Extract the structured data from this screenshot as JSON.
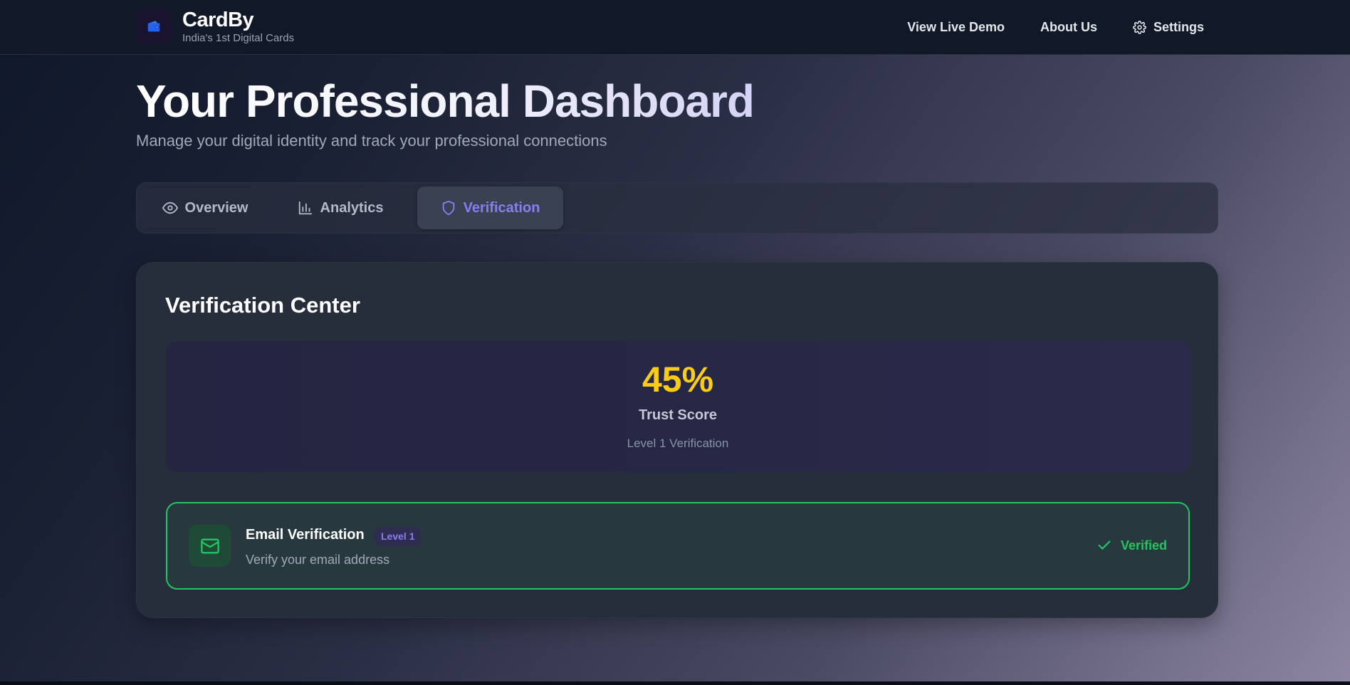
{
  "brand": {
    "name": "CardBy",
    "tagline": "India's 1st Digital Cards",
    "logo_icon": "wallet-icon"
  },
  "nav": {
    "items": [
      {
        "label": "View Live Demo"
      },
      {
        "label": "About Us"
      },
      {
        "label": "Settings",
        "icon": "gear-icon"
      }
    ]
  },
  "header": {
    "title": "Your Professional Dashboard",
    "subtitle": "Manage your digital identity and track your professional connections"
  },
  "tabs": [
    {
      "label": "Overview",
      "icon": "eye-icon",
      "active": false
    },
    {
      "label": "Analytics",
      "icon": "bar-chart-icon",
      "active": false
    },
    {
      "label": "Verification",
      "icon": "shield-icon",
      "active": true
    }
  ],
  "verification": {
    "title": "Verification Center",
    "trust": {
      "score": "45%",
      "label": "Trust Score",
      "level": "Level 1 Verification"
    },
    "items": [
      {
        "title": "Email Verification",
        "badge": "Level 1",
        "description": "Verify your email address",
        "status": "Verified",
        "icon": "mail-icon",
        "status_icon": "check-icon"
      }
    ]
  },
  "colors": {
    "accent": "#8b7cf6",
    "success": "#22c55e",
    "score": "#facc15",
    "topbar": "#111827"
  }
}
